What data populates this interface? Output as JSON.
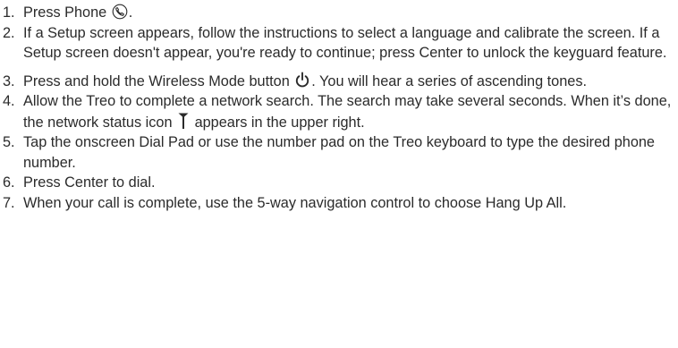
{
  "steps": [
    {
      "number": "1.",
      "before": "Press Phone ",
      "icon": "phone-icon",
      "after": "."
    },
    {
      "number": "2.",
      "text": "If a Setup screen appears, follow the instructions to select a language and calibrate the screen. If a Setup screen doesn't appear, you're ready to continue; press Center to unlock the keyguard feature."
    },
    {
      "number": "3.",
      "before": "Press and hold the Wireless Mode button ",
      "icon": "power-icon",
      "after": ". You will hear a series of ascending tones."
    },
    {
      "number": "4.",
      "before": "Allow the Treo to complete a network search. The search may take several seconds. When it’s done, the network status icon ",
      "icon": "antenna-icon",
      "after": " appears in the upper right."
    },
    {
      "number": "5.",
      "text": "Tap the onscreen Dial Pad or use the number pad on the Treo keyboard to type the desired phone number."
    },
    {
      "number": "6.",
      "text": "Press Center to dial."
    },
    {
      "number": "7.",
      "text": "When your call is complete, use the 5-way navigation control to choose Hang Up All."
    }
  ]
}
